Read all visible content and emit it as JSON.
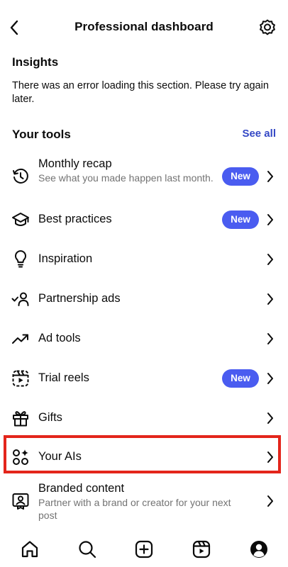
{
  "header": {
    "title": "Professional dashboard",
    "back_icon": "chevron-left-icon",
    "settings_icon": "gear-icon"
  },
  "insights": {
    "title": "Insights",
    "message": "There was an error loading this section. Please try again later."
  },
  "tools": {
    "title": "Your tools",
    "see_all": "See all",
    "items": [
      {
        "label": "Monthly recap",
        "sublabel": "See what you made happen last month.",
        "badge": "New",
        "icon": "history-icon"
      },
      {
        "label": "Best practices",
        "badge": "New",
        "icon": "graduation-cap-icon"
      },
      {
        "label": "Inspiration",
        "icon": "lightbulb-icon"
      },
      {
        "label": "Partnership ads",
        "icon": "partnership-icon"
      },
      {
        "label": "Ad tools",
        "icon": "trend-up-icon"
      },
      {
        "label": "Trial reels",
        "badge": "New",
        "icon": "reels-icon"
      },
      {
        "label": "Gifts",
        "icon": "gift-icon"
      },
      {
        "label": "Your AIs",
        "icon": "ai-sparkle-icon",
        "highlighted": true
      },
      {
        "label": "Branded content",
        "sublabel": "Partner with a brand or creator for your next post",
        "icon": "branded-content-icon"
      }
    ]
  },
  "bottom_nav": [
    "home-icon",
    "search-icon",
    "create-icon",
    "reels-icon",
    "profile-icon"
  ],
  "colors": {
    "accent": "#3448c5",
    "badge": "#4a5cf0",
    "highlight": "#e3251b",
    "secondary_text": "#737373"
  }
}
